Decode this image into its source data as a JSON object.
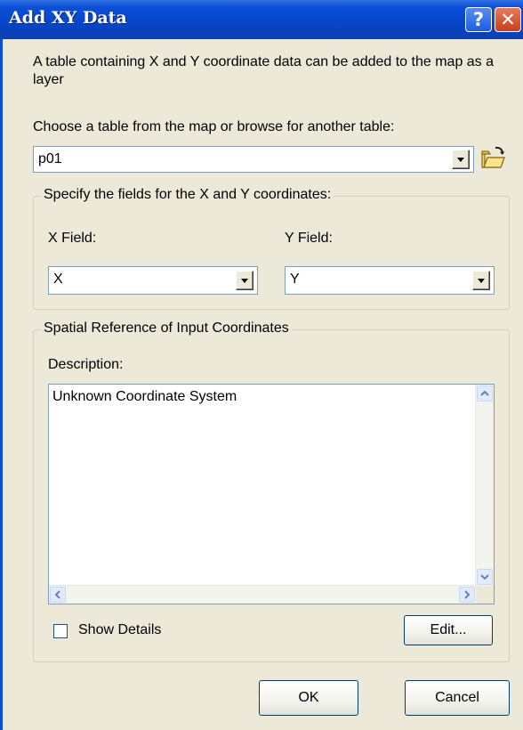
{
  "window": {
    "title": "Add XY Data",
    "help_glyph": "?",
    "close_glyph": "✕"
  },
  "intro_text": "A table containing X and Y coordinate data can be added to the map as a layer",
  "table_section": {
    "label": "Choose a table from the map or browse for another table:",
    "table_value": "p01"
  },
  "fields_group": {
    "title": "Specify the fields for the X and Y coordinates:",
    "x_label": "X Field:",
    "x_value": "X",
    "y_label": "Y Field:",
    "y_value": "Y"
  },
  "spatial_group": {
    "title": "Spatial Reference of Input Coordinates",
    "description_label": "Description:",
    "description_text": "Unknown Coordinate System",
    "show_details_label": "Show Details",
    "show_details_checked": false,
    "edit_label": "Edit..."
  },
  "buttons": {
    "ok_label": "OK",
    "cancel_label": "Cancel"
  },
  "icons": [
    "help-icon",
    "close-icon",
    "open-folder-icon",
    "chevron-down-icon",
    "chevron-up-icon",
    "chevron-left-icon",
    "chevron-right-icon"
  ]
}
